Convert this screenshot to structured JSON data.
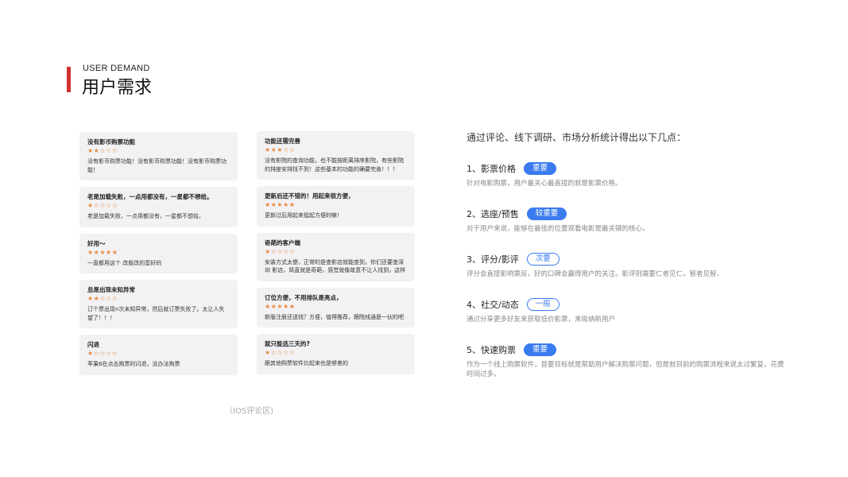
{
  "header": {
    "en": "USER DEMAND",
    "cn": "用户需求"
  },
  "reviews_left": [
    {
      "title": "没有影币购票功能",
      "stars": "★★☆☆☆",
      "body": "没有影币购票功能！没有影币购票功能！没有影币购票功能！"
    },
    {
      "title": "老是加载失败，一点用都没有，一星都不想给。",
      "stars": "★☆☆☆☆",
      "body": "老是加载失败，一点用都没有，一星都不想给。"
    },
    {
      "title": "好用～",
      "stars": "★★★★★",
      "body": "一直都用这个 改版改的蛮好的"
    },
    {
      "title": "总是出现未知异常",
      "stars": "★★☆☆☆",
      "body": "订个票出现n次未知异常，然后就订票失败了。太让人失望了！！！"
    },
    {
      "title": "闪退",
      "stars": "★☆☆☆☆",
      "body": "苹果6在点击购票时闪退，没办法购票"
    }
  ],
  "reviews_right": [
    {
      "title": "功能还需完善",
      "stars": "★★★☆☆",
      "body": "没有影院的查询功能，也不能按距离排序影院，有些影院的排座安排找不到！这些基本的功能的确要完善！！！"
    },
    {
      "title": "更新后还不错的！用起来很方便，",
      "stars": "★★★★★",
      "body": "更新过后用起来挺起方便的嘛！"
    },
    {
      "title": "奇葩的客户端",
      "stars": "★☆☆☆☆",
      "body": "安装方式太傻，正常的是查影店就能查到，你们还要查深圳 影店，简直就是奇葩，感觉就像故意不让人找到，这样"
    },
    {
      "title": "订位方便，不用排队是亮点，",
      "stars": "★★★★★",
      "body": "新版注册还送钱？方便，值得推荐，跟院线通是一伙的吧"
    },
    {
      "title": "就只能选三天的?",
      "stars": "★☆☆☆☆",
      "body": "跟其他购票软件比起来也是够差的"
    }
  ],
  "caption": "（IOS评论区)",
  "intro": "通过评论、线下调研、市场分析统计得出以下几点：",
  "points": [
    {
      "title": "1、影票价格",
      "badge": "重要",
      "badge_style": "solid",
      "desc": "针对电影购票，用户最关心最直接的就是影票价格。"
    },
    {
      "title": "2、选座/预售",
      "badge": "较重要",
      "badge_style": "solid",
      "desc": "对于用户来说，能够在最佳的位置观看电影是最关键的核心。"
    },
    {
      "title": "3、评分/影评",
      "badge": "次要",
      "badge_style": "outline",
      "desc": "评分会直接影响票房，好的口碑会赢得用户的关注。影评则需要仁者见仁，智者见智。"
    },
    {
      "title": "4、社交/动态",
      "badge": "一般",
      "badge_style": "outline",
      "desc": "通过分享更多好友来获取低价影票，来吸纳新用户"
    },
    {
      "title": "5、快速购票",
      "badge": "重要",
      "badge_style": "solid",
      "desc": "作为一个线上购票软件，首要目标就是帮助用户解决购票问题，但是就目前的购票流程来说太过繁复，花费时间过多。"
    }
  ],
  "colors": {
    "accent_red": "#d0312d",
    "badge_blue": "#3a7bf0",
    "star_orange": "#e8893b"
  }
}
